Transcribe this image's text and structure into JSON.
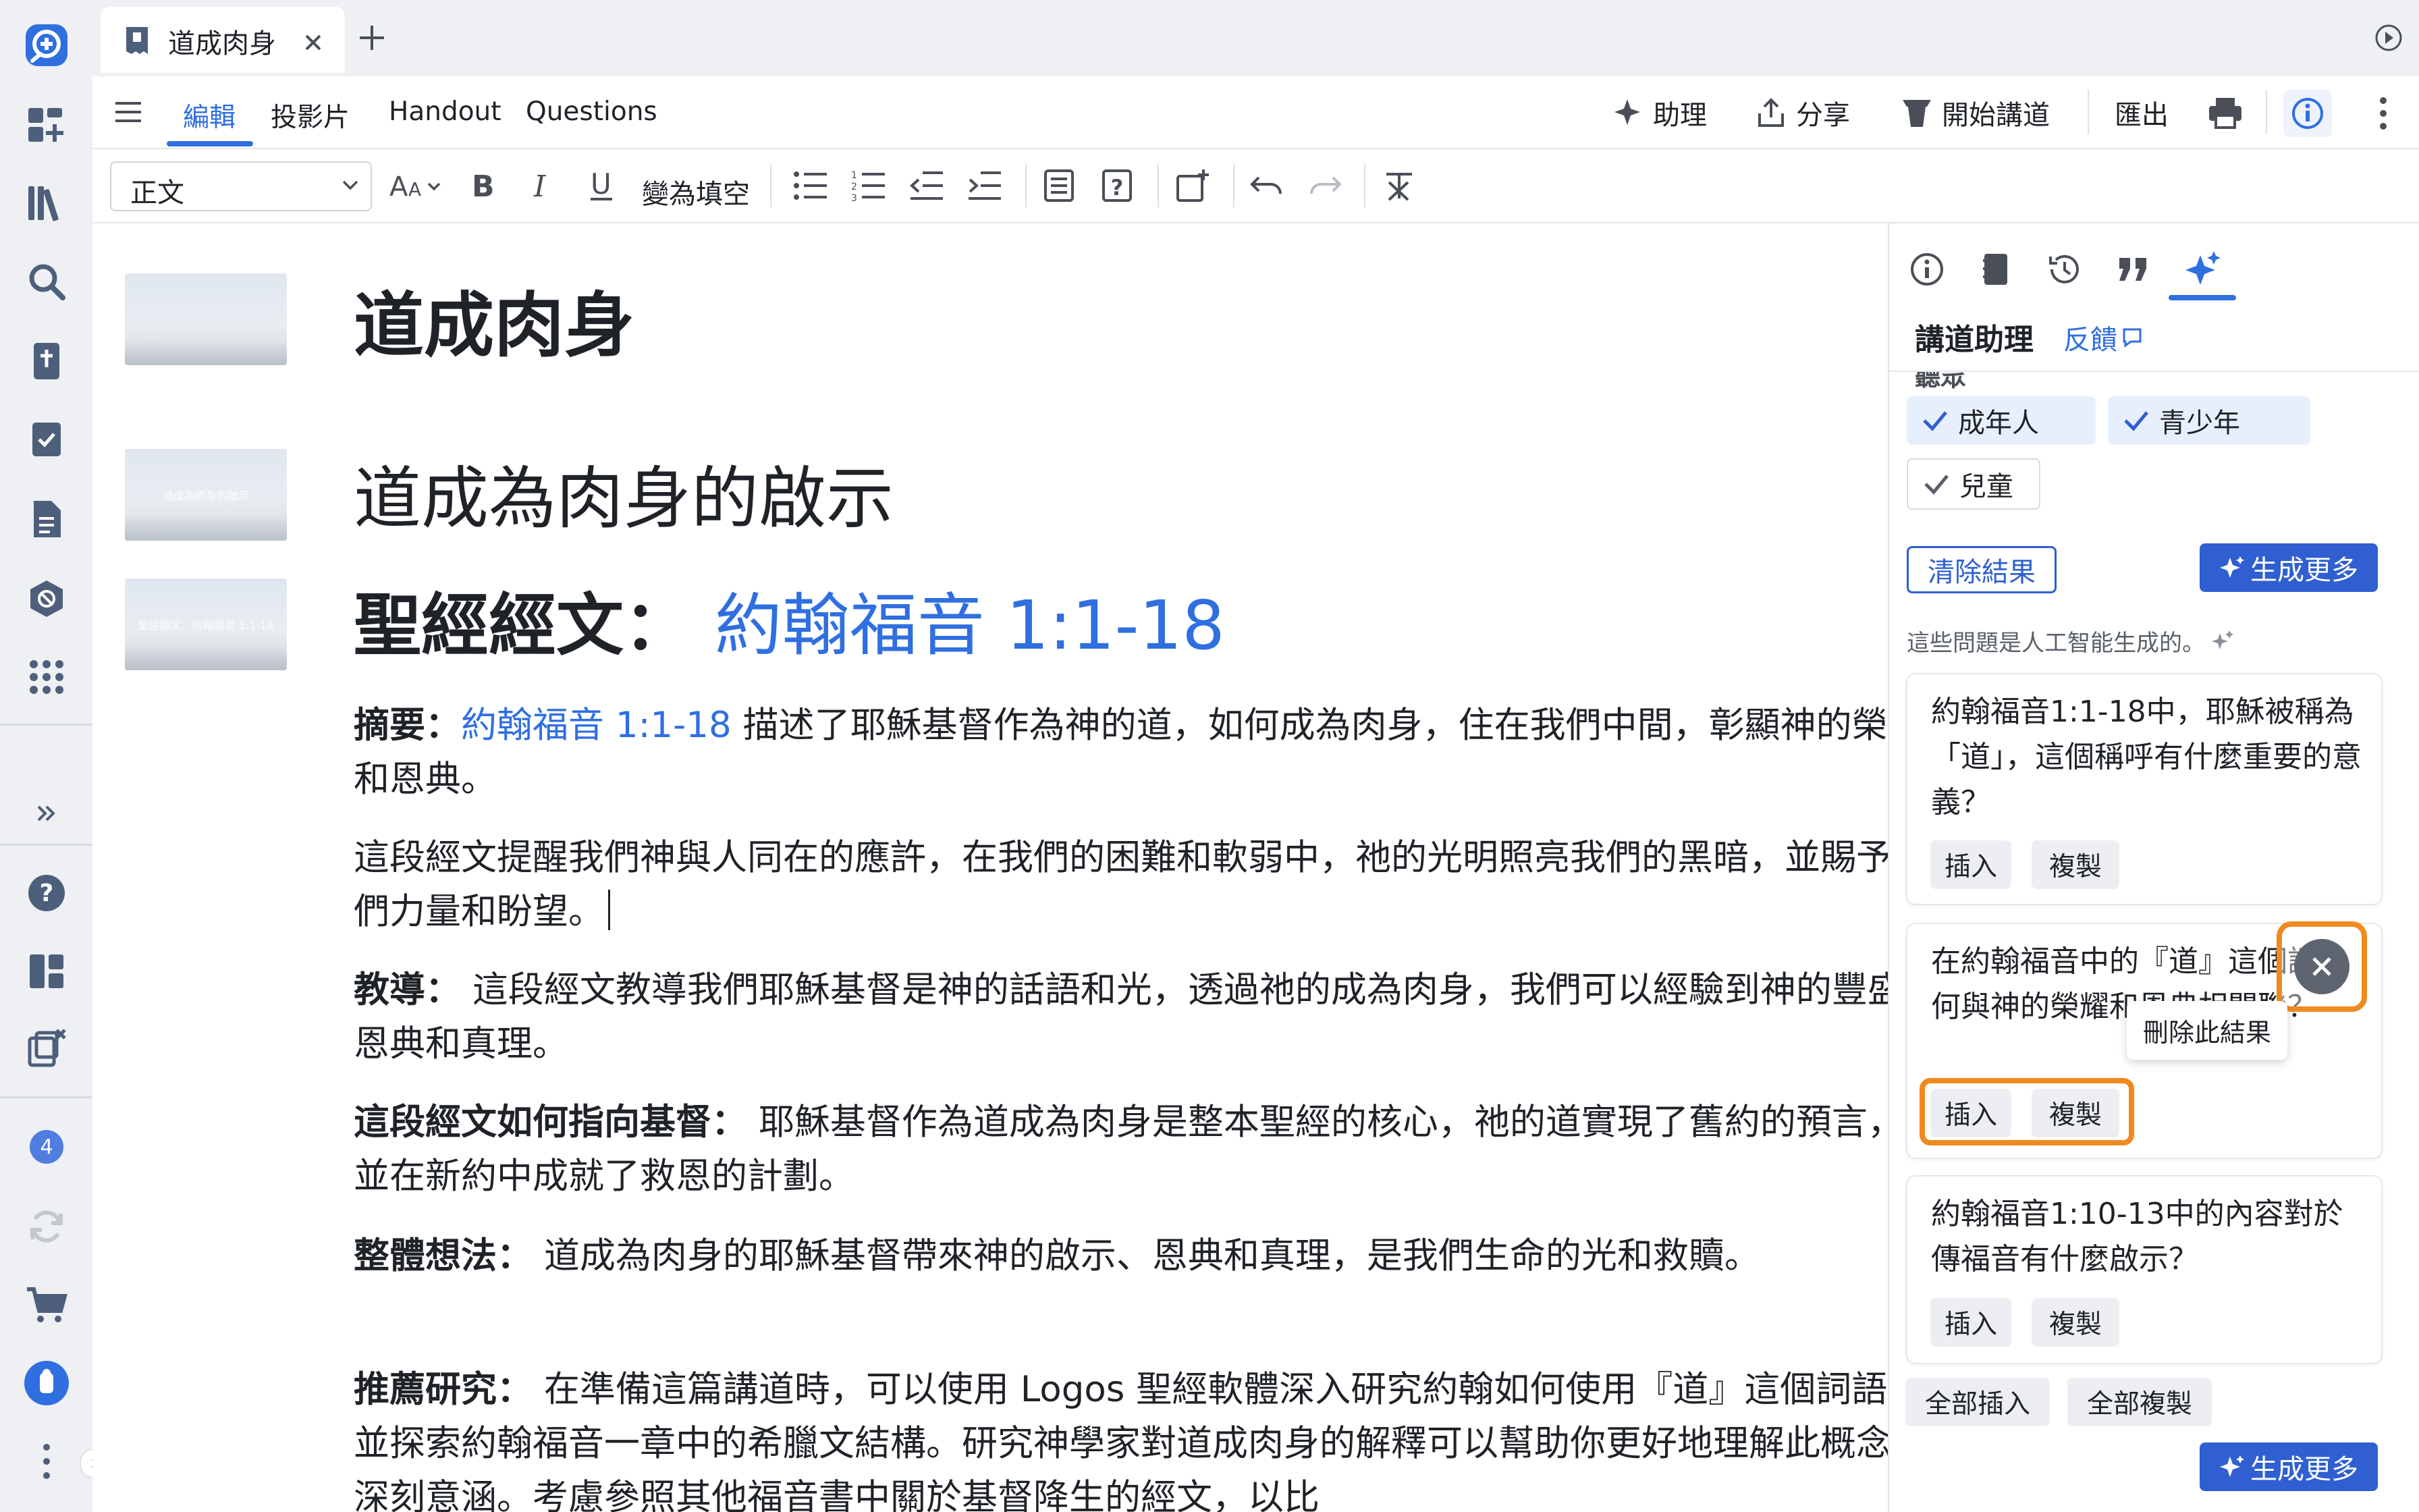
{
  "tab": {
    "title": "道成肉身"
  },
  "menu": {
    "items": [
      "編輯",
      "投影片",
      "Handout",
      "Questions"
    ],
    "assistant": "助理",
    "share": "分享",
    "preach": "開始講道",
    "export": "匯出"
  },
  "toolbar": {
    "style_select": "正文",
    "cloze": "變為填空"
  },
  "document": {
    "title": "道成肉身",
    "slide_heading": "道成為肉身的啟示",
    "scripture_label": "聖經經文：",
    "scripture_ref": "約翰福音 1:1-18",
    "summary_label": "摘要：",
    "summary_ref": "約翰福音 1:1-18",
    "summary_text": " 描述了耶穌基督作為神的道，如何成為肉身，住在我們中間，彰顯神的榮耀和恩典。",
    "para2": "這段經文提醒我們神與人同在的應許，在我們的困難和軟弱中，祂的光明照亮我們的黑暗，並賜予我們力量和盼望。",
    "teaching_label": "教導：",
    "teaching_text": " 這段經文教導我們耶穌基督是神的話語和光，透過祂的成為肉身，我們可以經驗到神的豐盛恩典和真理。",
    "christ_label": "這段經文如何指向基督：",
    "christ_text": " 耶穌基督作為道成為肉身是整本聖經的核心，祂的道實現了舊約的預言，並在新約中成就了救恩的計劃。",
    "overall_label": "整體想法：",
    "overall_text": " 道成為肉身的耶穌基督帶來神的啟示、恩典和真理，是我們生命的光和救贖。",
    "research_label": "推薦研究：",
    "research_text": " 在準備這篇講道時，可以使用 Logos 聖經軟體深入研究約翰如何使用『道』這個詞語，並探索約翰福音一章中的希臘文結構。研究神學家對道成肉身的解釋可以幫助你更好地理解此概念的深刻意涵。考慮參照其他福音書中關於基督降生的經文，以比",
    "thumb_captions": [
      "",
      "道成為肉身的啟示",
      "聖經經文：約翰福音 1:1-18"
    ]
  },
  "panel": {
    "title": "講道助理",
    "feedback": "反饋",
    "audience_label": "聽眾",
    "audience": [
      "成年人",
      "青少年",
      "兒童"
    ],
    "clear": "清除結果",
    "generate_more": "生成更多",
    "ai_note": "這些問題是人工智能生成的。",
    "questions": [
      "約翰福音1:1-18中，耶穌被稱為「道」，這個稱呼有什麼重要的意義？",
      "在約翰福音中的『道』這個詞如何與神的榮耀和恩典相關聯？",
      "約翰福音1:10-13中的內容對於傳福音有什麼啟示？"
    ],
    "insert": "插入",
    "copy": "複製",
    "delete_tooltip": "刪除此結果",
    "insert_all": "全部插入",
    "copy_all": "全部複製"
  },
  "rail": {
    "badge_count": "4"
  },
  "colors": {
    "accent": "#2f6fe0",
    "highlight": "#ef8a1f",
    "primary": "#2f5fd0"
  }
}
